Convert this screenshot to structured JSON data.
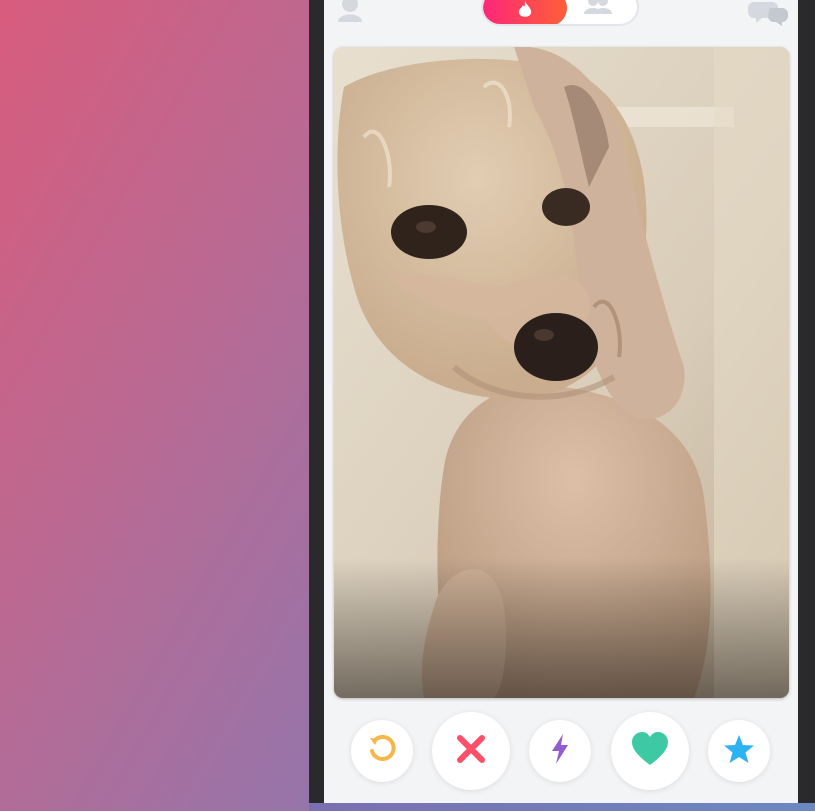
{
  "app": {
    "toggle": {
      "active_mode": "dating",
      "modes": [
        "dating",
        "social"
      ]
    },
    "card": {
      "photo_subject": "dog",
      "photo_description": ""
    },
    "actions": [
      {
        "name": "rewind",
        "icon": "rewind-icon",
        "color": "#f5b748"
      },
      {
        "name": "nope",
        "icon": "close-icon",
        "color": "#fd5068"
      },
      {
        "name": "boost",
        "icon": "lightning-icon",
        "color": "#915dd1"
      },
      {
        "name": "like",
        "icon": "heart-icon",
        "color": "#3cc9a3"
      },
      {
        "name": "super-like",
        "icon": "star-icon",
        "color": "#2db3f3"
      }
    ],
    "colors": {
      "brand_gradient_start": "#fd267a",
      "brand_gradient_end": "#ff6036",
      "background_gradient_start": "#d85c7d",
      "background_gradient_end": "#7689be"
    }
  }
}
